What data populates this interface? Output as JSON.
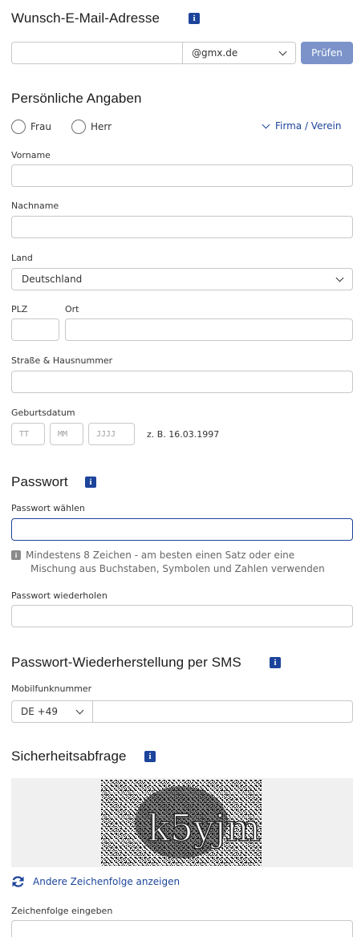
{
  "email_section": {
    "title": "Wunsch-E-Mail-Adresse",
    "info_icon": "info-icon",
    "username_value": "",
    "domain_selected": "@gmx.de",
    "check_button": "Prüfen"
  },
  "personal": {
    "title": "Persönliche Angaben",
    "salutation_options": [
      "Frau",
      "Herr"
    ],
    "company_link": "Firma / Verein",
    "firstname_label": "Vorname",
    "lastname_label": "Nachname",
    "country_label": "Land",
    "country_selected": "Deutschland",
    "zip_label": "PLZ",
    "city_label": "Ort",
    "street_label": "Straße & Hausnummer",
    "birthdate_label": "Geburtsdatum",
    "birthdate_placeholders": {
      "day": "TT",
      "month": "MM",
      "year": "JJJJ"
    },
    "birthdate_example": "z. B. 16.03.1997"
  },
  "password": {
    "title": "Passwort",
    "choose_label": "Passwort wählen",
    "hint_line1": "Mindestens 8 Zeichen - am besten einen Satz oder eine",
    "hint_line2": "Mischung aus Buchstaben, Symbolen und Zahlen verwenden",
    "repeat_label": "Passwort wiederholen"
  },
  "sms_recovery": {
    "title": "Passwort-Wiederherstellung per SMS",
    "mobile_label": "Mobilfunknummer",
    "country_code": "DE +49"
  },
  "captcha": {
    "title": "Sicherheitsabfrage",
    "image_text": "k5yjm",
    "refresh_link": "Andere Zeichenfolge anzeigen",
    "input_label": "Zeichenfolge eingeben"
  },
  "colors": {
    "accent": "#1c449b",
    "button_bg": "#7b93c9",
    "focus_border": "#1c449b"
  }
}
